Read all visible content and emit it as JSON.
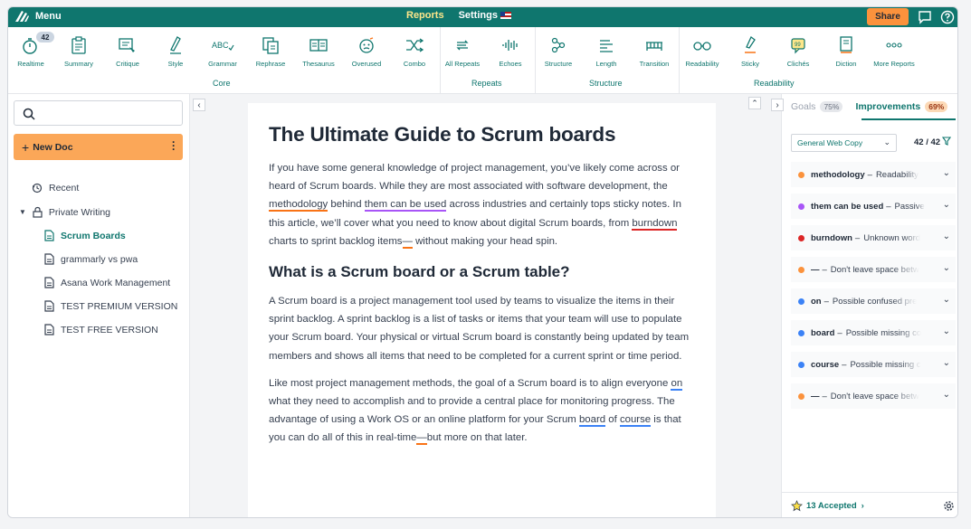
{
  "topbar": {
    "menu_label": "Menu",
    "tabs": [
      {
        "label": "Reports"
      },
      {
        "label": "Settings"
      }
    ],
    "share_label": "Share"
  },
  "toolbar": {
    "realtime_badge": "42",
    "tools": [
      {
        "label": "Realtime",
        "icon": "stopwatch-icon"
      },
      {
        "label": "Summary",
        "icon": "clipboard-icon"
      },
      {
        "label": "Critique",
        "icon": "critique-icon"
      },
      {
        "label": "Style",
        "icon": "pen-icon"
      },
      {
        "label": "Grammar",
        "icon": "abc-icon"
      },
      {
        "label": "Rephrase",
        "icon": "rephrase-icon"
      },
      {
        "label": "Thesaurus",
        "icon": "book-icon"
      },
      {
        "label": "Overused",
        "icon": "face-icon"
      },
      {
        "label": "Combo",
        "icon": "shuffle-icon"
      },
      {
        "label": "All Repeats",
        "icon": "repeat-icon"
      },
      {
        "label": "Echoes",
        "icon": "waveform-icon"
      },
      {
        "label": "Structure",
        "icon": "structure-icon"
      },
      {
        "label": "Length",
        "icon": "lines-icon"
      },
      {
        "label": "Transition",
        "icon": "bridge-icon"
      },
      {
        "label": "Readability",
        "icon": "glasses-icon"
      },
      {
        "label": "Sticky",
        "icon": "sticky-pen-icon"
      },
      {
        "label": "Clichés",
        "icon": "speech-bubble-icon"
      },
      {
        "label": "Diction",
        "icon": "diction-icon"
      },
      {
        "label": "More Reports",
        "icon": "more-icon"
      }
    ],
    "groups": {
      "core": "Core",
      "repeats": "Repeats",
      "structure": "Structure",
      "readability": "Readability"
    }
  },
  "sidebar": {
    "new_doc": "New Doc",
    "recent": "Recent",
    "folder": "Private Writing",
    "docs": [
      {
        "label": "Scrum Boards"
      },
      {
        "label": "grammarly vs pwa"
      },
      {
        "label": "Asana Work Management"
      },
      {
        "label": "TEST PREMIUM VERSION"
      },
      {
        "label": "TEST FREE VERSION"
      }
    ]
  },
  "document": {
    "title": "The Ultimate Guide to Scrum boards",
    "p1": {
      "a": "If you have some general knowledge of project management, you’ve likely come across or heard of Scrum boards. While they are most associated with software development, the ",
      "w1": "methodology",
      "b": " behind ",
      "w2": "them can be used",
      "c": " across industries and certainly tops sticky notes. In this article, we’ll cover what you need to know about digital Scrum boards, from ",
      "w3": "burndown",
      "d": " charts to sprint backlog items",
      "w4": "—",
      "e": " without making your head spin."
    },
    "h2": "What is a Scrum board or a Scrum table?",
    "p2": "A Scrum board is a project management tool used by teams to visualize the items in their sprint backlog. A sprint backlog is a list of tasks or items that your team will use to populate your Scrum board. Your physical or virtual Scrum board is constantly being updated by team members and shows all items that need to be completed for a current sprint or time period.",
    "p3": {
      "a": "Like most project management methods, the goal of a Scrum board is to align everyone ",
      "w1": "on",
      "b": " what they need to accomplish and to provide a central place for monitoring progress. The advantage of using a Work OS or an online platform for your Scrum ",
      "w2": "board",
      "c": " of ",
      "w3": "course",
      "d": " is that you can do all of this in real-time",
      "w4": "—",
      "e": "but more on that later."
    }
  },
  "panel": {
    "tab_goals": "Goals",
    "goals_pct": "75%",
    "tab_improvements": "Improvements",
    "improvements_pct": "69%",
    "filter": "General Web Copy",
    "count": "42 / 42",
    "issues": [
      {
        "term": "methodology",
        "desc": "Readability",
        "color": "#fb923c"
      },
      {
        "term": "them can be used",
        "desc": "Passive",
        "color": "#a855f7"
      },
      {
        "term": "burndown",
        "desc": "Unknown word",
        "color": "#dc2626"
      },
      {
        "term": "—",
        "desc": "Don't leave space betw",
        "color": "#fb923c"
      },
      {
        "term": "on",
        "desc": "Possible confused pre",
        "color": "#3b82f6"
      },
      {
        "term": "board",
        "desc": "Possible missing co",
        "color": "#3b82f6"
      },
      {
        "term": "course",
        "desc": "Possible missing c",
        "color": "#3b82f6"
      },
      {
        "term": "—",
        "desc": "Don't leave space betw",
        "color": "#fb923c"
      }
    ],
    "accepted": "13 Accepted"
  }
}
